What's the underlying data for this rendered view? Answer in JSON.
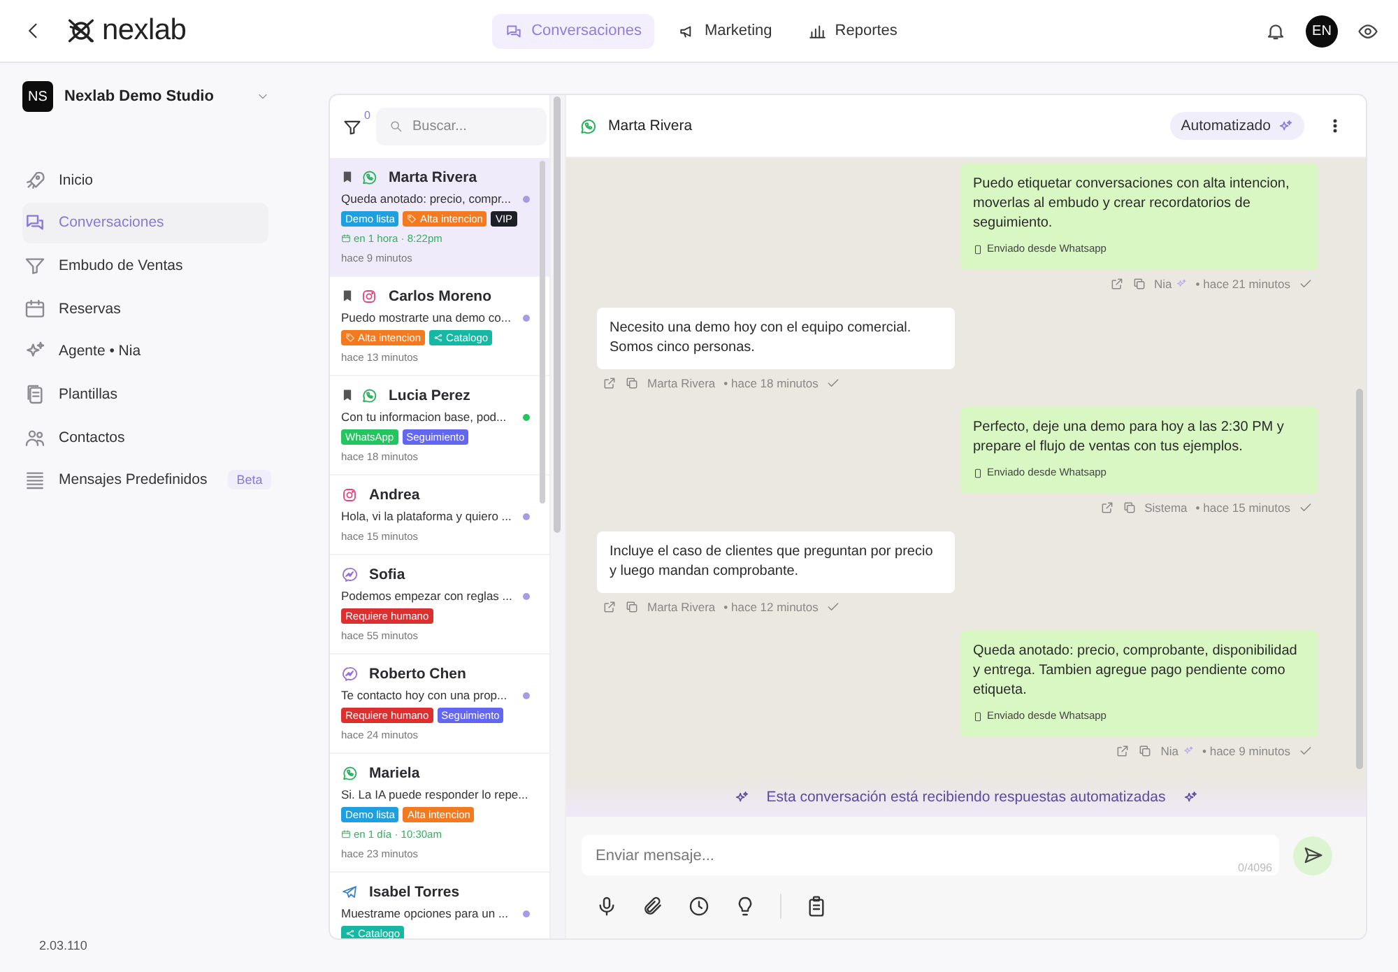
{
  "header": {
    "logo": "nexlab",
    "tabs": [
      {
        "label": "Conversaciones",
        "selected": true
      },
      {
        "label": "Marketing",
        "selected": false
      },
      {
        "label": "Reportes",
        "selected": false
      }
    ],
    "avatar": "EN"
  },
  "sidebar": {
    "workspace": {
      "initials": "NS",
      "name": "Nexlab Demo Studio"
    },
    "items": [
      {
        "label": "Inicio",
        "selected": false
      },
      {
        "label": "Conversaciones",
        "selected": true
      },
      {
        "label": "Embudo de Ventas",
        "selected": false
      },
      {
        "label": "Reservas",
        "selected": false
      },
      {
        "label": "Agente • Nia",
        "selected": false
      },
      {
        "label": "Plantillas",
        "selected": false
      },
      {
        "label": "Contactos",
        "selected": false
      },
      {
        "label": "Mensajes Predefinidos",
        "selected": false,
        "badge": "Beta"
      }
    ],
    "version": "2.03.110"
  },
  "conversation_list": {
    "filter_count": "0",
    "search": {
      "placeholder": "Buscar..."
    },
    "conversations": [
      {
        "name": "Marta Rivera",
        "kind": "whatsapp",
        "bookmarked": true,
        "selected": true,
        "preview": "Queda anotado: precio, compr...",
        "unread": true,
        "color": "#a99be3",
        "tags": [
          {
            "label": "Demo lista",
            "kind": "plain",
            "color": "#1ea0e0"
          },
          {
            "label": "Alta intencion",
            "kind": "tag",
            "color": "#f47a20"
          },
          {
            "label": "VIP",
            "kind": "plain",
            "color": "#1c1f26"
          }
        ],
        "reminder": "en 1 hora · 8:22pm",
        "time": "hace 9 minutos"
      },
      {
        "name": "Carlos Moreno",
        "kind": "instagram",
        "bookmarked": true,
        "selected": false,
        "preview": "Puedo mostrarte una demo co...",
        "unread": true,
        "color": "#a99be3",
        "tags": [
          {
            "label": "Alta intencion",
            "kind": "tag",
            "color": "#f47a20"
          },
          {
            "label": "Catalogo",
            "kind": "link",
            "color": "#16b8a3"
          }
        ],
        "time": "hace 13 minutos"
      },
      {
        "name": "Lucia Perez",
        "kind": "whatsapp",
        "bookmarked": true,
        "selected": false,
        "preview": "Con tu informacion base, pod...",
        "unread": true,
        "color": "#22c55e",
        "tags": [
          {
            "label": "WhatsApp",
            "kind": "plain",
            "color": "#22c55e"
          },
          {
            "label": "Seguimiento",
            "kind": "plain",
            "color": "#6366f1"
          }
        ],
        "time": "hace 18 minutos"
      },
      {
        "name": "Andrea",
        "kind": "instagram",
        "bookmarked": false,
        "selected": false,
        "preview": "Hola, vi la plataforma y quiero ...",
        "unread": true,
        "color": "#a99be3",
        "time": "hace 15 minutos"
      },
      {
        "name": "Sofia",
        "kind": "messenger",
        "bookmarked": false,
        "selected": false,
        "preview": "Podemos empezar con reglas ...",
        "unread": true,
        "color": "#a99be3",
        "tags": [
          {
            "label": "Requiere humano",
            "kind": "plain",
            "color": "#dc2f2f"
          }
        ],
        "time": "hace 55 minutos"
      },
      {
        "name": "Roberto Chen",
        "kind": "messenger",
        "bookmarked": false,
        "selected": false,
        "preview": "Te contacto hoy con una prop...",
        "unread": true,
        "color": "#a99be3",
        "tags": [
          {
            "label": "Requiere humano",
            "kind": "plain",
            "color": "#dc2f2f"
          },
          {
            "label": "Seguimiento",
            "kind": "plain",
            "color": "#6366f1"
          }
        ],
        "time": "hace 24 minutos"
      },
      {
        "name": "Mariela",
        "kind": "whatsapp",
        "bookmarked": false,
        "selected": false,
        "preview": "Si. La IA puede responder lo repe...",
        "unread": false,
        "tags": [
          {
            "label": "Demo lista",
            "kind": "plain",
            "color": "#1ea0e0"
          },
          {
            "label": "Alta intencion",
            "kind": "plain",
            "color": "#f47a20"
          }
        ],
        "reminder": "en 1 día · 10:30am",
        "time": "hace 23 minutos"
      },
      {
        "name": "Isabel Torres",
        "kind": "telegram",
        "bookmarked": false,
        "selected": false,
        "preview": "Muestrame opciones para un ...",
        "unread": true,
        "color": "#a99be3",
        "tags": [
          {
            "label": "Catalogo",
            "kind": "link",
            "color": "#16b8a3"
          }
        ]
      }
    ]
  },
  "chat": {
    "contact": {
      "name": "Marta Rivera"
    },
    "mode": "Automatizado",
    "messages": [
      {
        "kind": "sent",
        "text": "Puedo etiquetar conversaciones con alta intencion, moverlas al embudo y crear recordatorios de seguimiento.",
        "source": "Enviado desde Whatsapp",
        "author": "Nia",
        "ai": true,
        "time": "• hace 21 minutos"
      },
      {
        "kind": "received",
        "text": "Necesito una demo hoy con el equipo comercial. Somos cinco personas.",
        "author": "Marta Rivera",
        "ai": false,
        "time": "• hace 18 minutos"
      },
      {
        "kind": "sent",
        "text": "Perfecto, deje una demo para hoy a las 2:30 PM y prepare el flujo de ventas con tus ejemplos.",
        "source": "Enviado desde Whatsapp",
        "author": "Sistema",
        "ai": false,
        "time": "• hace 15 minutos"
      },
      {
        "kind": "received",
        "text": "Incluye el caso de clientes que preguntan por precio y luego mandan comprobante.",
        "author": "Marta Rivera",
        "ai": false,
        "time": "• hace 12 minutos"
      },
      {
        "kind": "sent",
        "text": "Queda anotado: precio, comprobante, disponibilidad y entrega. Tambien agregue pago pendiente como etiqueta.",
        "source": "Enviado desde Whatsapp",
        "author": "Nia",
        "ai": true,
        "time": "• hace 9 minutos"
      }
    ],
    "banner": "Esta conversación está recibiendo respuestas automatizadas",
    "composer": {
      "placeholder": "Enviar mensaje...",
      "counter": "0/4096"
    }
  }
}
